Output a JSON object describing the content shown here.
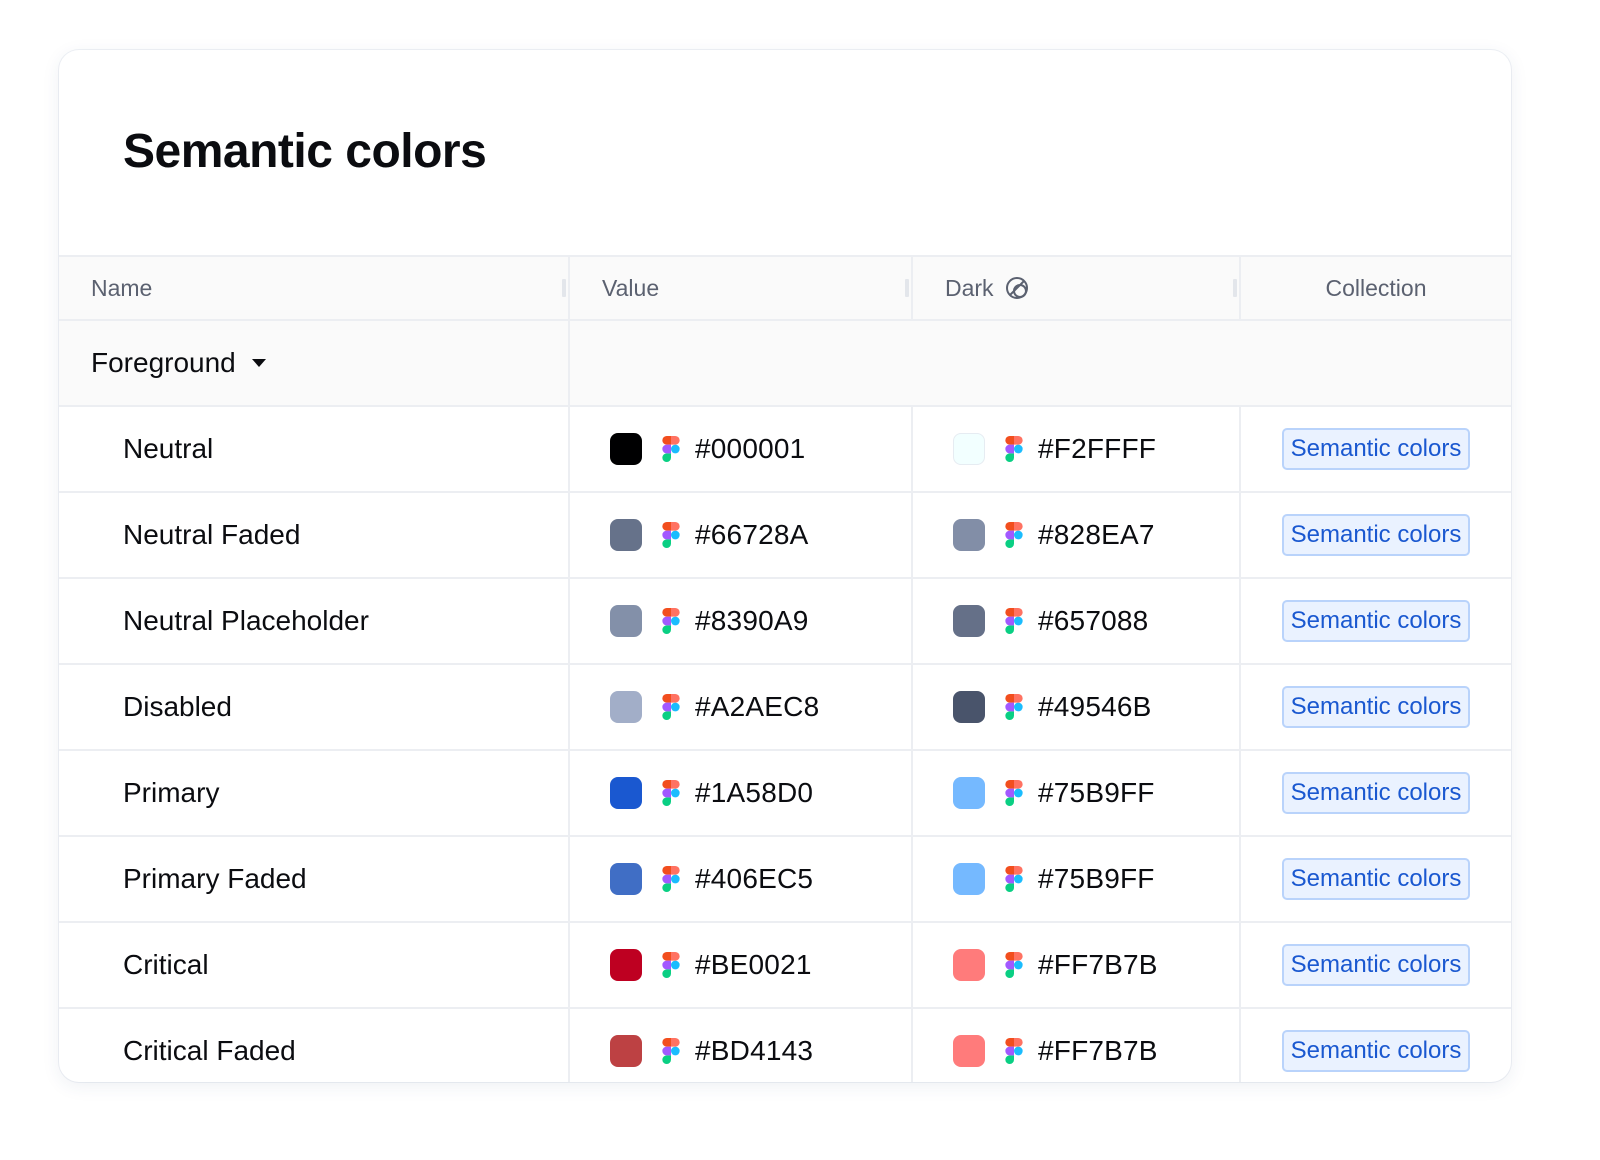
{
  "title": "Semantic colors",
  "columns": {
    "name": "Name",
    "value": "Value",
    "dark": "Dark",
    "collection": "Collection"
  },
  "group": {
    "label": "Foreground",
    "icon": "caret-down-icon"
  },
  "icons": {
    "dark_header": "theme-toggle-icon",
    "source": "figma-icon"
  },
  "rows": [
    {
      "name": "Neutral",
      "value": "#000001",
      "dark": "#F2FFFF",
      "collection": "Semantic colors"
    },
    {
      "name": "Neutral Faded",
      "value": "#66728A",
      "dark": "#828EA7",
      "collection": "Semantic colors"
    },
    {
      "name": "Neutral Placeholder",
      "value": "#8390A9",
      "dark": "#657088",
      "collection": "Semantic colors"
    },
    {
      "name": "Disabled",
      "value": "#A2AEC8",
      "dark": "#49546B",
      "collection": "Semantic colors"
    },
    {
      "name": "Primary",
      "value": "#1A58D0",
      "dark": "#75B9FF",
      "collection": "Semantic colors"
    },
    {
      "name": "Primary Faded",
      "value": "#406EC5",
      "dark": "#75B9FF",
      "collection": "Semantic colors"
    },
    {
      "name": "Critical",
      "value": "#BE0021",
      "dark": "#FF7B7B",
      "collection": "Semantic colors"
    },
    {
      "name": "Critical Faded",
      "value": "#BD4143",
      "dark": "#FF7B7B",
      "collection": "Semantic colors"
    }
  ]
}
